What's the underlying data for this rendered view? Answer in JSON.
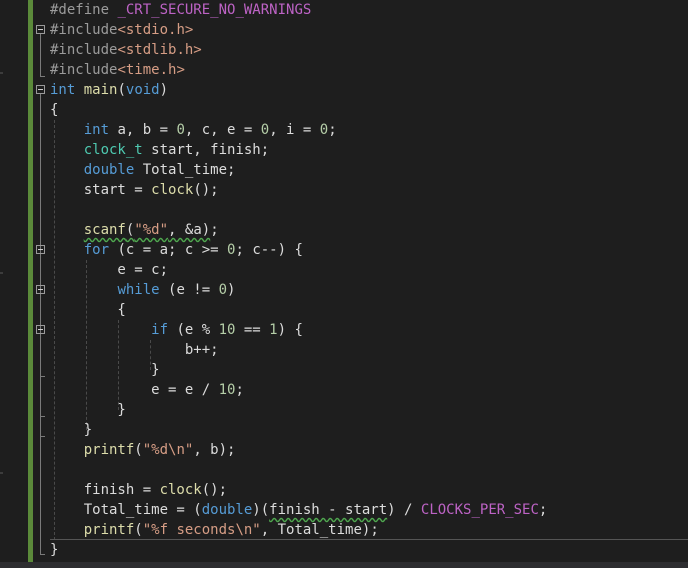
{
  "editor": {
    "lines": [
      [
        {
          "t": "#define ",
          "c": "pp"
        },
        {
          "t": "_CRT_SECURE_NO_WARNINGS",
          "c": "mac"
        }
      ],
      [
        {
          "t": "#include",
          "c": "pp"
        },
        {
          "t": "<stdio.h>",
          "c": "inc"
        }
      ],
      [
        {
          "t": "#include",
          "c": "pp"
        },
        {
          "t": "<stdlib.h>",
          "c": "inc"
        }
      ],
      [
        {
          "t": "#include",
          "c": "pp"
        },
        {
          "t": "<time.h>",
          "c": "inc"
        }
      ],
      [
        {
          "t": "int",
          "c": "kw"
        },
        {
          "t": " ",
          "c": "pl"
        },
        {
          "t": "main",
          "c": "fn"
        },
        {
          "t": "(",
          "c": "pl"
        },
        {
          "t": "void",
          "c": "kw"
        },
        {
          "t": ")",
          "c": "pl"
        }
      ],
      [
        {
          "t": "{",
          "c": "pl"
        }
      ],
      [
        {
          "t": "    ",
          "c": "pl"
        },
        {
          "t": "int",
          "c": "kw"
        },
        {
          "t": " a, b = ",
          "c": "pl"
        },
        {
          "t": "0",
          "c": "num"
        },
        {
          "t": ", c, e = ",
          "c": "pl"
        },
        {
          "t": "0",
          "c": "num"
        },
        {
          "t": ", i = ",
          "c": "pl"
        },
        {
          "t": "0",
          "c": "num"
        },
        {
          "t": ";",
          "c": "pl"
        }
      ],
      [
        {
          "t": "    ",
          "c": "pl"
        },
        {
          "t": "clock_t",
          "c": "ty"
        },
        {
          "t": " start, finish;",
          "c": "pl"
        }
      ],
      [
        {
          "t": "    ",
          "c": "pl"
        },
        {
          "t": "double",
          "c": "kw"
        },
        {
          "t": " Total_time;",
          "c": "pl"
        }
      ],
      [
        {
          "t": "    start = ",
          "c": "pl"
        },
        {
          "t": "clock",
          "c": "fn"
        },
        {
          "t": "();",
          "c": "pl"
        }
      ],
      [],
      [
        {
          "t": "    ",
          "c": "pl"
        },
        {
          "t": "scanf",
          "c": "fn",
          "sq": true
        },
        {
          "t": "(",
          "c": "pl",
          "sq": true
        },
        {
          "t": "\"%d\"",
          "c": "str",
          "sq": true
        },
        {
          "t": ", &a)",
          "c": "pl",
          "sq": true
        },
        {
          "t": ";",
          "c": "pl"
        }
      ],
      [
        {
          "t": "    ",
          "c": "pl"
        },
        {
          "t": "for",
          "c": "kw"
        },
        {
          "t": " (c = a; c >= ",
          "c": "pl"
        },
        {
          "t": "0",
          "c": "num"
        },
        {
          "t": "; c--) {",
          "c": "pl"
        }
      ],
      [
        {
          "t": "        e = c;",
          "c": "pl"
        }
      ],
      [
        {
          "t": "        ",
          "c": "pl"
        },
        {
          "t": "while",
          "c": "kw"
        },
        {
          "t": " (e != ",
          "c": "pl"
        },
        {
          "t": "0",
          "c": "num"
        },
        {
          "t": ")",
          "c": "pl"
        }
      ],
      [
        {
          "t": "        {",
          "c": "pl"
        }
      ],
      [
        {
          "t": "            ",
          "c": "pl"
        },
        {
          "t": "if",
          "c": "kw"
        },
        {
          "t": " (e % ",
          "c": "pl"
        },
        {
          "t": "10",
          "c": "num"
        },
        {
          "t": " == ",
          "c": "pl"
        },
        {
          "t": "1",
          "c": "num"
        },
        {
          "t": ") {",
          "c": "pl"
        }
      ],
      [
        {
          "t": "                b++;",
          "c": "pl"
        }
      ],
      [
        {
          "t": "            }",
          "c": "pl"
        }
      ],
      [
        {
          "t": "            e = e / ",
          "c": "pl"
        },
        {
          "t": "10",
          "c": "num"
        },
        {
          "t": ";",
          "c": "pl"
        }
      ],
      [
        {
          "t": "        }",
          "c": "pl"
        }
      ],
      [
        {
          "t": "    }",
          "c": "pl"
        }
      ],
      [
        {
          "t": "    ",
          "c": "pl"
        },
        {
          "t": "printf",
          "c": "fn"
        },
        {
          "t": "(",
          "c": "pl"
        },
        {
          "t": "\"%d\\n\"",
          "c": "str"
        },
        {
          "t": ", b);",
          "c": "pl"
        }
      ],
      [],
      [
        {
          "t": "    finish = ",
          "c": "pl"
        },
        {
          "t": "clock",
          "c": "fn"
        },
        {
          "t": "();",
          "c": "pl"
        }
      ],
      [
        {
          "t": "    Total_time = (",
          "c": "pl"
        },
        {
          "t": "double",
          "c": "kw"
        },
        {
          "t": ")(",
          "c": "pl"
        },
        {
          "t": "finish - start",
          "c": "pl",
          "sq": true
        },
        {
          "t": ") / ",
          "c": "pl"
        },
        {
          "t": "CLOCKS_PER_SEC",
          "c": "mac"
        },
        {
          "t": ";",
          "c": "pl"
        }
      ],
      [
        {
          "t": "    ",
          "c": "pl"
        },
        {
          "t": "printf",
          "c": "fn"
        },
        {
          "t": "(",
          "c": "pl"
        },
        {
          "t": "\"%f seconds\\n\"",
          "c": "str"
        },
        {
          "t": ", Total_time);",
          "c": "pl"
        }
      ],
      [
        {
          "t": "}",
          "c": "pl"
        }
      ]
    ]
  }
}
